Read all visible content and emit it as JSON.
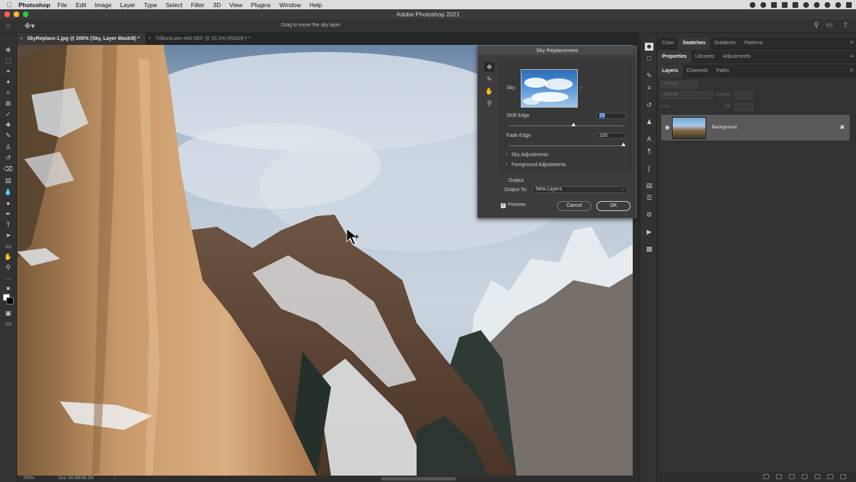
{
  "menubar": {
    "app": "Photoshop",
    "items": [
      "File",
      "Edit",
      "Image",
      "Layer",
      "Type",
      "Select",
      "Filter",
      "3D",
      "View",
      "Plugins",
      "Window",
      "Help"
    ]
  },
  "window": {
    "title": "Adobe Photoshop 2021"
  },
  "options": {
    "hint": "Drag to move the sky layer."
  },
  "tabs": [
    {
      "label": "SkyReplace-1.jpg @ 200% (Sky, Layer Mask/8) *",
      "active": true
    },
    {
      "label": "TrilliumLake-445.NEF @ 33.3% (RGB/8*) *",
      "active": false
    }
  ],
  "status": {
    "zoom": "200%",
    "doc": "Doc: 98.2M/98.2M"
  },
  "panels": {
    "top_tabs": [
      "Color",
      "Swatches",
      "Gradients",
      "Patterns"
    ],
    "top_active": "Swatches",
    "mid_tabs": [
      "Properties",
      "Libraries",
      "Adjustments"
    ],
    "mid_active": "Properties",
    "layer_tabs": [
      "Layers",
      "Channels",
      "Paths"
    ],
    "layer_active": "Layers",
    "kind_placeholder": "Kind",
    "blend_mode": "Normal",
    "opacity_label": "Opacity:",
    "lock_label": "Lock:",
    "fill_label": "Fill:",
    "layer_name": "Background"
  },
  "dialog": {
    "title": "Sky Replacement",
    "sky_label": "Sky:",
    "shift_edge_label": "Shift Edge",
    "shift_edge_value": "29",
    "shift_edge_fraction": 0.56,
    "fade_edge_label": "Fade Edge",
    "fade_edge_value": "100",
    "fade_edge_fraction": 1.0,
    "sky_adjustments": "Sky Adjustments",
    "foreground_adjustments": "Foreground Adjustments",
    "output_heading": "Output",
    "output_to_label": "Output To:",
    "output_to_value": "New Layers",
    "preview_label": "Preview",
    "cancel_label": "Cancel",
    "ok_label": "OK"
  },
  "colors": {
    "accent": "#2a5fb5",
    "close_light": "#ff5f57",
    "min_light": "#febc2e",
    "max_light": "#28c840"
  }
}
